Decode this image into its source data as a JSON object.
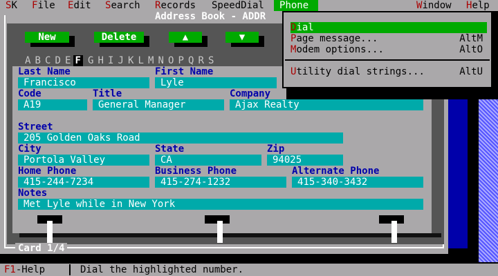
{
  "menubar": {
    "items": [
      {
        "hot": "S",
        "rest": "K"
      },
      {
        "hot": "F",
        "rest": "ile"
      },
      {
        "hot": "E",
        "rest": "dit"
      },
      {
        "hot": "S",
        "rest": "earch"
      },
      {
        "hot": "R",
        "rest": "ecords"
      },
      {
        "hot": "",
        "rest": "SpeedDial"
      },
      {
        "hot": "P",
        "rest": "hone"
      },
      {
        "hot": "W",
        "rest": "indow"
      },
      {
        "hot": "H",
        "rest": "elp"
      }
    ]
  },
  "window": {
    "title": "Address Book - ADDR",
    "card_label": "Card 1/4"
  },
  "buttons": {
    "new": "New",
    "delete": "Delete",
    "up": "▲",
    "down": "▼"
  },
  "alphabet": [
    "A",
    "B",
    "C",
    "D",
    "E",
    "F",
    "G",
    "H",
    "I",
    "J",
    "K",
    "L",
    "M",
    "N",
    "O",
    "P",
    "Q",
    "R",
    "S"
  ],
  "alphabet_selected": "F",
  "fields": {
    "last_name": {
      "label": "Last Name",
      "value": "Francisco"
    },
    "first_name": {
      "label": "First Name",
      "value": "Lyle"
    },
    "code": {
      "label": "Code",
      "value": "A19"
    },
    "title": {
      "label": "Title",
      "value": "General Manager"
    },
    "company": {
      "label": "Company",
      "value": "Ajax Realty"
    },
    "street": {
      "label": "Street",
      "value": "205 Golden Oaks Road"
    },
    "city": {
      "label": "City",
      "value": "Portola Valley"
    },
    "state": {
      "label": "State",
      "value": "CA"
    },
    "zip": {
      "label": "Zip",
      "value": "94025"
    },
    "home_phone": {
      "label": "Home Phone",
      "value": "415-244-7234"
    },
    "business_phone": {
      "label": "Business Phone",
      "value": "415-274-1232"
    },
    "alternate_phone": {
      "label": "Alternate Phone",
      "value": "415-340-3432"
    },
    "notes": {
      "label": "Notes",
      "value": "Met Lyle while in New York"
    }
  },
  "phone_menu": {
    "items": [
      {
        "hot": "D",
        "rest": "ial",
        "key": ""
      },
      {
        "hot": "P",
        "rest": "age message...",
        "key": "AltM"
      },
      {
        "hot": "M",
        "rest": "odem options...",
        "key": "AltO"
      },
      {
        "hot": "U",
        "rest": "tility dial strings...",
        "key": "AltU"
      }
    ]
  },
  "statusbar": {
    "help_hot": "F1",
    "help_rest": "-Help",
    "message": "Dial the highlighted number."
  },
  "colors": {
    "menu_bg": "#aaa8aa",
    "hotkey": "#aa0000",
    "highlight": "#00aa00",
    "field_bg": "#00aaaa",
    "label": "#0000aa"
  }
}
